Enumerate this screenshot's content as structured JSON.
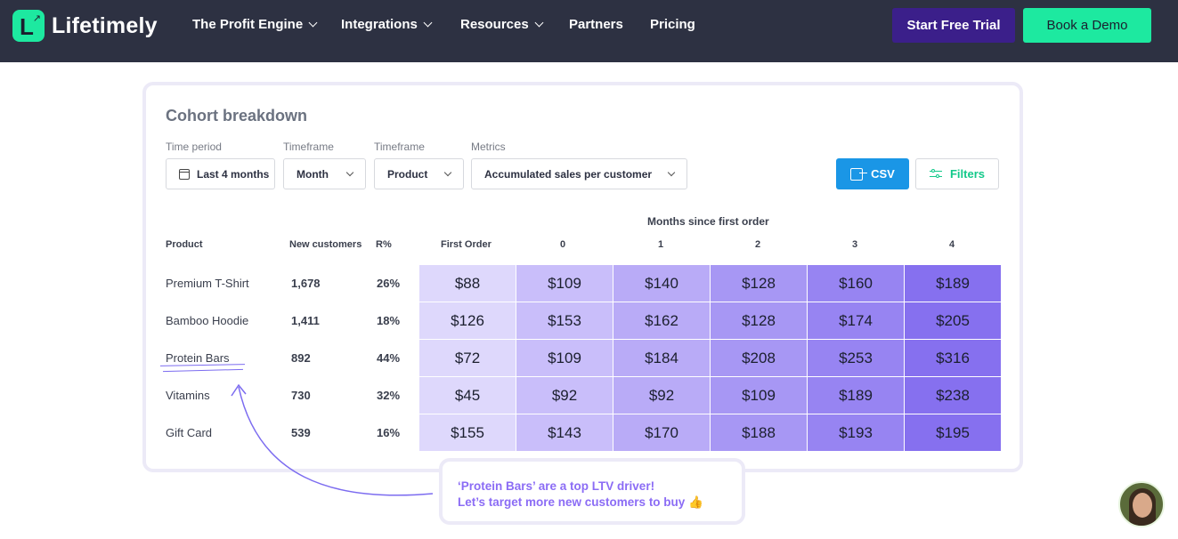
{
  "nav": {
    "brand": "Lifetimely",
    "items": [
      {
        "label": "The Profit Engine",
        "dropdown": true
      },
      {
        "label": "Integrations",
        "dropdown": true
      },
      {
        "label": "Resources",
        "dropdown": true
      },
      {
        "label": "Partners",
        "dropdown": false
      },
      {
        "label": "Pricing",
        "dropdown": false
      }
    ],
    "trial_label": "Start Free Trial",
    "demo_label": "Book a Demo"
  },
  "card": {
    "title": "Cohort breakdown",
    "filters": [
      {
        "label": "Time period",
        "value": "Last 4 months"
      },
      {
        "label": "Timeframe",
        "value": "Month"
      },
      {
        "label": "Timeframe",
        "value": "Product"
      },
      {
        "label": "Metrics",
        "value": "Accumulated sales per customer"
      }
    ],
    "csv_label": "CSV",
    "filters_label": "Filters"
  },
  "table": {
    "months_title": "Months since first order",
    "headers": [
      "Product",
      "New customers",
      "R%",
      "First Order",
      "0",
      "1",
      "2",
      "3",
      "4"
    ],
    "rows": [
      {
        "product": "Premium T-Shirt",
        "new_customers": "1,678",
        "r": "26%",
        "cells": [
          "$88",
          "$109",
          "$140",
          "$128",
          "$160",
          "$189"
        ]
      },
      {
        "product": "Bamboo Hoodie",
        "new_customers": "1,411",
        "r": "18%",
        "cells": [
          "$126",
          "$153",
          "$162",
          "$128",
          "$174",
          "$205"
        ]
      },
      {
        "product": "Protein Bars",
        "new_customers": "892",
        "r": "44%",
        "cells": [
          "$72",
          "$109",
          "$184",
          "$208",
          "$253",
          "$316"
        ]
      },
      {
        "product": "Vitamins",
        "new_customers": "730",
        "r": "32%",
        "cells": [
          "$45",
          "$92",
          "$92",
          "$109",
          "$189",
          "$238"
        ]
      },
      {
        "product": "Gift Card",
        "new_customers": "539",
        "r": "16%",
        "cells": [
          "$155",
          "$143",
          "$170",
          "$188",
          "$193",
          "$195"
        ]
      }
    ],
    "column_colors": [
      "#ded8fc",
      "#c9befa",
      "#b9abf7",
      "#a797f4",
      "#9784f2",
      "#8670ef"
    ]
  },
  "callout": {
    "line1": "‘Protein Bars’ are a top LTV driver!",
    "line2": "Let’s target more new customers to buy 👍"
  },
  "icons": {
    "logo": "lifetimely-logo-icon",
    "calendar": "calendar-icon",
    "csv": "export-icon",
    "filters": "sliders-icon",
    "chat": "chat-avatar"
  },
  "colors": {
    "nav_bg": "#2d3142",
    "accent_green": "#1de9a0",
    "trial_purple": "#3b1f8a",
    "csv_blue": "#1a96e6",
    "callout_purple": "#8b6cf5"
  }
}
